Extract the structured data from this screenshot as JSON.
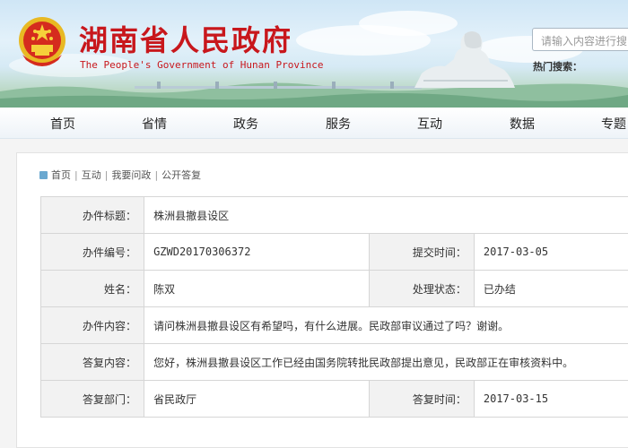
{
  "header": {
    "title_cn": "湖南省人民政府",
    "title_en": "The People's Government of Hunan Province",
    "search_placeholder": "请输入内容进行搜",
    "hot_label": "热门搜索："
  },
  "nav": [
    "首页",
    "省情",
    "政务",
    "服务",
    "互动",
    "数据",
    "专题"
  ],
  "breadcrumb": {
    "items": [
      "首页",
      "互动",
      "我要问政",
      "公开答复"
    ],
    "separator": "|"
  },
  "record": {
    "title_label": "办件标题：",
    "title_value": "株洲县撤县设区",
    "number_label": "办件编号：",
    "number_value": "GZWD20170306372",
    "submit_time_label": "提交时间：",
    "submit_time_value": "2017-03-05",
    "name_label": "姓名：",
    "name_value": "陈双",
    "status_label": "处理状态：",
    "status_value": "已办结",
    "content_label": "办件内容：",
    "content_value": "请问株洲县撤县设区有希望吗，有什么进展。民政部审议通过了吗？谢谢。",
    "reply_label": "答复内容：",
    "reply_value": "您好，株洲县撤县设区工作已经由国务院转批民政部提出意见，民政部正在审核资料中。",
    "dept_label": "答复部门：",
    "dept_value": "省民政厅",
    "reply_time_label": "答复时间：",
    "reply_time_value": "2017-03-15"
  },
  "colors": {
    "brand_red": "#c8171c",
    "label_bg": "#f2f2f2",
    "border": "#d6d6d6"
  }
}
